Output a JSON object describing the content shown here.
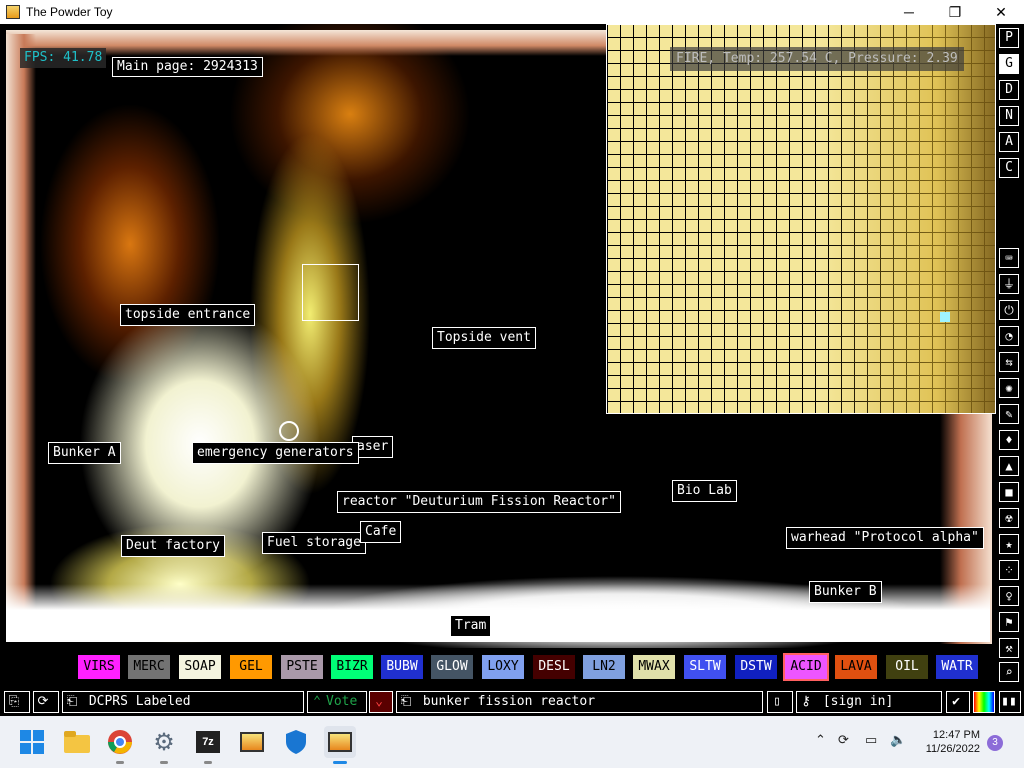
{
  "window": {
    "title": "The Powder Toy",
    "minimize": "─",
    "maximize": "❐",
    "close": "✕"
  },
  "hud": {
    "fps": "FPS: 41.78",
    "main_page": "Main page: 2924313"
  },
  "zoom": {
    "info": "FIRE, Temp: 257.54 C, Pressure: 2.39"
  },
  "labels": {
    "topside_entrance": "topside entrance",
    "topside_vent": "Topside vent",
    "bunker_a": "Bunker A",
    "emergency_generators": "emergency generators",
    "laser": "aser",
    "reactor": "reactor \"Deuturium Fission Reactor\"",
    "bio_lab": "Bio Lab",
    "deut_factory": "Deut factory",
    "fuel_storage": "Fuel storage",
    "cafe": "Cafe",
    "warhead": "warhead \"Protocol alpha\"",
    "bunker_b": "Bunker B",
    "tram": "Tram"
  },
  "menu_tabs": [
    "P",
    "G",
    "D",
    "N",
    "A",
    "C"
  ],
  "menu_selected": "G",
  "category_icons": [
    "keyboard-icon",
    "plug-icon",
    "power-icon",
    "sensor-icon",
    "force-icon",
    "explosive-icon",
    "pen-icon",
    "liquid-icon",
    "powder-icon",
    "solid-icon",
    "radioactive-icon",
    "special-icon",
    "gas-icon",
    "life-icon",
    "tool-icon",
    "favorite-icon",
    "search-icon"
  ],
  "elements": [
    {
      "name": "VIRS",
      "bg": "#ff20ff",
      "fg": "#000000"
    },
    {
      "name": "MERC",
      "bg": "#737373",
      "fg": "#000000"
    },
    {
      "name": "SOAP",
      "bg": "#f4f4e0",
      "fg": "#000000"
    },
    {
      "name": "GEL",
      "bg": "#ff9900",
      "fg": "#000000"
    },
    {
      "name": "PSTE",
      "bg": "#aa99aa",
      "fg": "#000000"
    },
    {
      "name": "BIZR",
      "bg": "#00ff77",
      "fg": "#000000"
    },
    {
      "name": "BUBW",
      "bg": "#2030d0",
      "fg": "#ffffff"
    },
    {
      "name": "GLOW",
      "bg": "#445464",
      "fg": "#ffffff"
    },
    {
      "name": "LOXY",
      "bg": "#80a0ef",
      "fg": "#000000"
    },
    {
      "name": "DESL",
      "bg": "#440000",
      "fg": "#ffffff"
    },
    {
      "name": "LN2",
      "bg": "#80a0df",
      "fg": "#000000"
    },
    {
      "name": "MWAX",
      "bg": "#e0e0aa",
      "fg": "#000000"
    },
    {
      "name": "SLTW",
      "bg": "#4050f0",
      "fg": "#ffffff"
    },
    {
      "name": "DSTW",
      "bg": "#1020c0",
      "fg": "#ffffff"
    },
    {
      "name": "ACID",
      "bg": "#ed55ff",
      "fg": "#000000"
    },
    {
      "name": "LAVA",
      "bg": "#e05010",
      "fg": "#000000"
    },
    {
      "name": "OIL",
      "bg": "#404010",
      "fg": "#ffffff"
    },
    {
      "name": "WATR",
      "bg": "#2030d0",
      "fg": "#ffffff"
    }
  ],
  "bottom": {
    "save_name": "DCPRS Labeled",
    "vote": "Vote",
    "tags": "bunker fission reactor",
    "sign_in": "[sign in]"
  },
  "taskbar": {
    "time": "12:47 PM",
    "date": "11/26/2022",
    "notifications": "3",
    "zip_label": "7z"
  }
}
